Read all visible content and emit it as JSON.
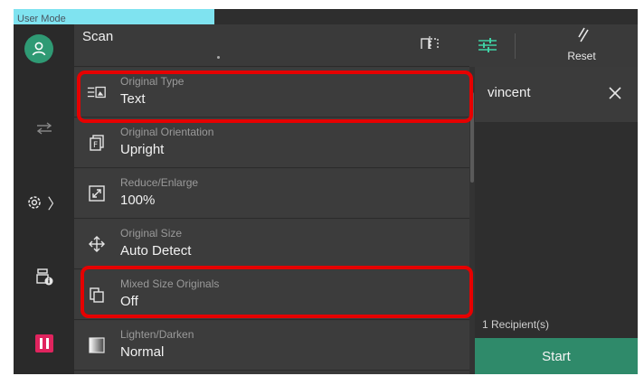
{
  "header": {
    "mode_label": "User Mode",
    "title": "Scan",
    "reset_label": "Reset",
    "icons": [
      "user-icon",
      "duplex-icon",
      "adjust-icon",
      "reset-icon"
    ]
  },
  "nav": {
    "items": [
      "transfer-icon",
      "settings-icon",
      "job-status-icon",
      "pause-icon"
    ],
    "settings_chevron": "〉"
  },
  "settings": {
    "items": [
      {
        "label": "Original Type",
        "value": "Text",
        "icon": "original-type-icon",
        "highlighted": true
      },
      {
        "label": "Original Orientation",
        "value": "Upright",
        "icon": "orientation-icon",
        "highlighted": false
      },
      {
        "label": "Reduce/Enlarge",
        "value": "100%",
        "icon": "reduce-enlarge-icon",
        "highlighted": false
      },
      {
        "label": "Original Size",
        "value": "Auto Detect",
        "icon": "original-size-icon",
        "highlighted": false
      },
      {
        "label": "Mixed Size Originals",
        "value": "Off",
        "icon": "mixed-size-icon",
        "highlighted": true
      },
      {
        "label": "Lighten/Darken",
        "value": "Normal",
        "icon": "lighten-darken-icon",
        "highlighted": false
      }
    ]
  },
  "recipients": {
    "name": "vincent",
    "count_label": "1 Recipient(s)"
  },
  "actions": {
    "start_label": "Start"
  },
  "colors": {
    "accent": "#2f8a6a",
    "mode_tab": "#7fe3f0",
    "highlight": "#e60000",
    "pause": "#e0245e"
  }
}
